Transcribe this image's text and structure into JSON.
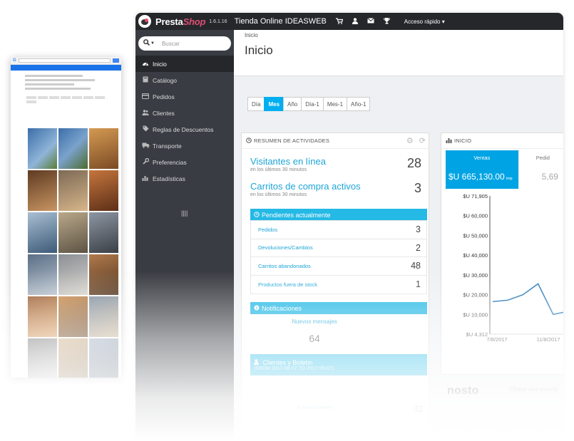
{
  "topbar": {
    "brand_main": "Presta",
    "brand_accent": "Shop",
    "version": "1.6.1.16",
    "shop_name": "Tienda Online IDEASWEB",
    "quick_access": "Acceso rápido ▾",
    "icons": [
      "cart-icon",
      "user-icon",
      "mail-icon",
      "trophy-icon"
    ]
  },
  "sidebar": {
    "search_placeholder": "Buscar",
    "items": [
      {
        "label": "Inicio",
        "icon": "dashboard-icon",
        "active": true
      },
      {
        "label": "Catálogo",
        "icon": "book-icon"
      },
      {
        "label": "Pedidos",
        "icon": "credit-card-icon"
      },
      {
        "label": "Clientes",
        "icon": "users-icon"
      },
      {
        "label": "Reglas de Descuentos",
        "icon": "tag-icon"
      },
      {
        "label": "Transporte",
        "icon": "truck-icon"
      },
      {
        "label": "Preferencias",
        "icon": "wrench-icon"
      },
      {
        "label": "Estadísticas",
        "icon": "bar-chart-icon"
      }
    ],
    "collapse": "||||"
  },
  "page": {
    "breadcrumb": "Inicio",
    "title": "Inicio"
  },
  "range_buttons": [
    "Día",
    "Mes",
    "Año",
    "Día-1",
    "Mes-1",
    "Año-1"
  ],
  "range_active": "Mes",
  "activity": {
    "title": "RESUMEN DE ACTIVIDADES",
    "visitors_label": "Visitantes en línea",
    "visitors_sub": "en los últimos 30 minutos",
    "visitors_value": "28",
    "carts_label": "Carritos de compra activos",
    "carts_sub": "en los últimos 30 minutos",
    "carts_value": "3",
    "pending_title": "Pendientes actualmente",
    "pending": [
      {
        "label": "Pedidos",
        "value": "3"
      },
      {
        "label": "Devoluciones/Cambios",
        "value": "2"
      },
      {
        "label": "Carritos abandonados",
        "value": "48"
      },
      {
        "label": "Productos fuera de stock",
        "value": "1"
      }
    ],
    "notif_title": "Notificaciones",
    "messages_label": "Nuevos mensajes",
    "messages_value": "64",
    "clients_title": "Clientes y Boletín",
    "clients_range": "(FROM 2017-08-07 TO 2017-09-07)",
    "newsletter_label": "Nuevos clientes",
    "newsletter_value": "32"
  },
  "chart_panel": {
    "title": "INICIO",
    "tab_active_label": "Ventas",
    "tab_active_value": "$U 665,130.00",
    "tab_active_suffix": "imp",
    "tab_inactive_label": "Pedid",
    "tab_inactive_value": "5,69"
  },
  "chart_data": {
    "type": "line",
    "y_ticks": [
      "$U 71,905",
      "$U 60,000",
      "$U 50,000",
      "$U 40,000",
      "$U 30,000",
      "$U 20,000",
      "$U 10,000",
      "$U 4,312"
    ],
    "x_ticks": [
      "7/8/2017",
      "11/8/2017"
    ],
    "ylim": [
      4312,
      71905
    ],
    "series": [
      {
        "values": [
          16500,
          17200,
          20000,
          25500,
          10000,
          11500
        ]
      }
    ]
  },
  "nosto": {
    "logo": "nosto",
    "text": "Ofrece una experie"
  },
  "colors": {
    "accent": "#00aff0",
    "sidebar_bg": "#393c42",
    "topbar_bg": "#25272b",
    "brand_pink": "#df4f74",
    "link": "#1fa5d6"
  }
}
